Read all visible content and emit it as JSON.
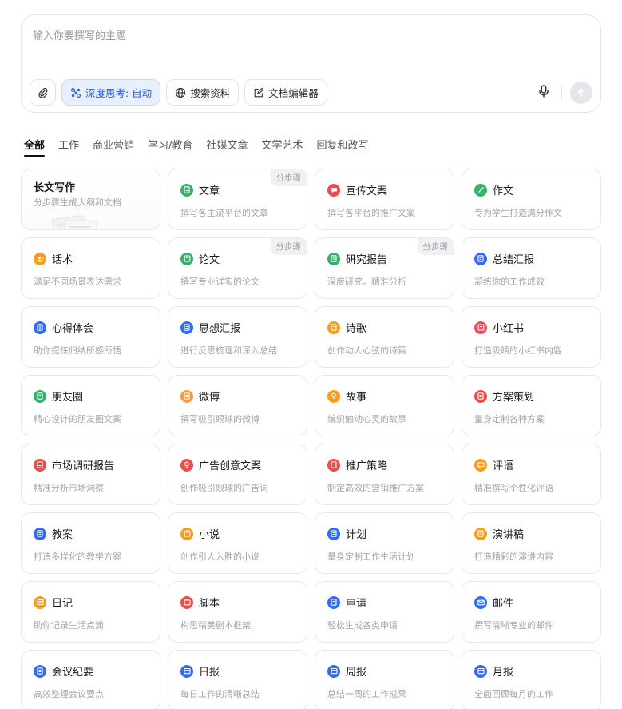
{
  "input": {
    "placeholder": "输入你要撰写的主题"
  },
  "toolbar": {
    "deep_think_label": "深度思考: 自动",
    "search_label": "搜索资料",
    "doc_editor_label": "文档编辑器"
  },
  "tabs": [
    {
      "label": "全部",
      "active": true
    },
    {
      "label": "工作"
    },
    {
      "label": "商业营销"
    },
    {
      "label": "学习/教育"
    },
    {
      "label": "社媒文章"
    },
    {
      "label": "文学艺术"
    },
    {
      "label": "回复和改写"
    }
  ],
  "cards": [
    {
      "title": "长文写作",
      "desc": "分步骤生成大纲和文档",
      "long": true
    },
    {
      "title": "文章",
      "desc": "撰写各主流平台的文章",
      "color": "#33b36b",
      "icon": "doc-icon",
      "badge": "分步骤"
    },
    {
      "title": "宣传文案",
      "desc": "撰写各平台的推广文案",
      "color": "#f04b4b",
      "icon": "chat-icon"
    },
    {
      "title": "作文",
      "desc": "专为学生打造满分作文",
      "color": "#33b36b",
      "icon": "pen-icon"
    },
    {
      "title": "话术",
      "desc": "满足不同场景表达需求",
      "color": "#ff9a1a",
      "icon": "user-icon"
    },
    {
      "title": "论文",
      "desc": "撰写专业详实的论文",
      "color": "#33b36b",
      "icon": "book-icon",
      "badge": "分步骤"
    },
    {
      "title": "研究报告",
      "desc": "深度研究，精准分析",
      "color": "#33b36b",
      "icon": "report-icon",
      "badge": "分步骤"
    },
    {
      "title": "总结汇报",
      "desc": "凝练你的工作成效",
      "color": "#2f6bff",
      "icon": "doc-icon"
    },
    {
      "title": "心得体会",
      "desc": "助你提炼归纳所感所悟",
      "color": "#2f6bff",
      "icon": "note-icon"
    },
    {
      "title": "思想汇报",
      "desc": "进行反思梳理和深入总结",
      "color": "#2f6bff",
      "icon": "doc-icon"
    },
    {
      "title": "诗歌",
      "desc": "创作动人心弦的诗篇",
      "color": "#ff9a1a",
      "icon": "poem-icon"
    },
    {
      "title": "小红书",
      "desc": "打造吸睛的小红书内容",
      "color": "#f04b5e",
      "icon": "book-icon"
    },
    {
      "title": "朋友圈",
      "desc": "精心设计的朋友圈文案",
      "color": "#33b36b",
      "icon": "moments-icon"
    },
    {
      "title": "微博",
      "desc": "撰写吸引眼球的微博",
      "color": "#ff9a3a",
      "icon": "weibo-icon"
    },
    {
      "title": "故事",
      "desc": "编织触动心灵的故事",
      "color": "#ff9a1a",
      "icon": "bulb-icon"
    },
    {
      "title": "方案策划",
      "desc": "量身定制各种方案",
      "color": "#f04b4b",
      "icon": "plan-icon"
    },
    {
      "title": "市场调研报告",
      "desc": "精准分析市场洞察",
      "color": "#f04b4b",
      "icon": "survey-icon"
    },
    {
      "title": "广告创意文案",
      "desc": "创作吸引眼球的广告词",
      "color": "#f04b4b",
      "icon": "bulb-icon"
    },
    {
      "title": "推广策略",
      "desc": "制定高效的营销推广方案",
      "color": "#f04b4b",
      "icon": "strategy-icon"
    },
    {
      "title": "评语",
      "desc": "精准撰写个性化评语",
      "color": "#ff9a1a",
      "icon": "comment-icon"
    },
    {
      "title": "教案",
      "desc": "打造多样化的教学方案",
      "color": "#2f6bff",
      "icon": "doc-icon"
    },
    {
      "title": "小说",
      "desc": "创作引人入胜的小说",
      "color": "#ff9a1a",
      "icon": "book-icon"
    },
    {
      "title": "计划",
      "desc": "量身定制工作生活计划",
      "color": "#2f6bff",
      "icon": "plan-icon"
    },
    {
      "title": "演讲稿",
      "desc": "打造精彩的演讲内容",
      "color": "#ff9a1a",
      "icon": "speech-icon"
    },
    {
      "title": "日记",
      "desc": "助你记录生活点滴",
      "color": "#ff9a1a",
      "icon": "diary-icon"
    },
    {
      "title": "脚本",
      "desc": "构思精美剧本框架",
      "color": "#f04b4b",
      "icon": "script-icon"
    },
    {
      "title": "申请",
      "desc": "轻松生成各类申请",
      "color": "#2f6bff",
      "icon": "apply-icon"
    },
    {
      "title": "邮件",
      "desc": "撰写清晰专业的邮件",
      "color": "#2f6bff",
      "icon": "mail-icon"
    },
    {
      "title": "会议纪要",
      "desc": "高效整理会议要点",
      "color": "#2f6bff",
      "icon": "meeting-icon"
    },
    {
      "title": "日报",
      "desc": "每日工作的清晰总结",
      "color": "#2f6bff",
      "icon": "calendar-icon"
    },
    {
      "title": "周报",
      "desc": "总结一周的工作成果",
      "color": "#2f6bff",
      "icon": "calendar-icon"
    },
    {
      "title": "月报",
      "desc": "全面回顾每月的工作",
      "color": "#2f6bff",
      "icon": "calendar-icon"
    }
  ]
}
